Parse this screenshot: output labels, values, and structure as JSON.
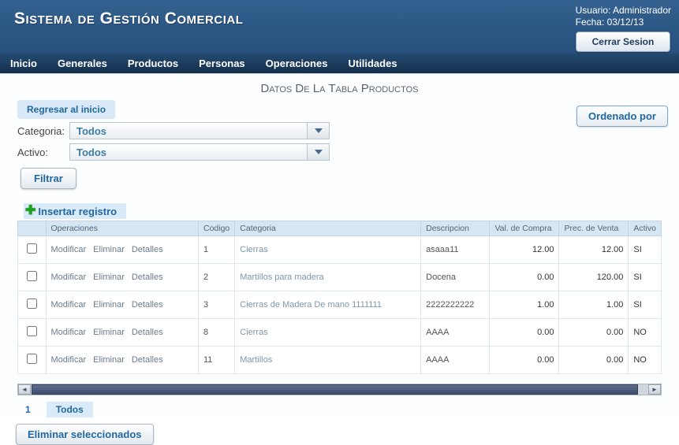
{
  "header": {
    "title": "Sistema de Gestión Comercial",
    "user_label": "Usuario: Administrador",
    "date_label": "Fecha: 03/12/13",
    "logout_button": "Cerrar Sesion"
  },
  "nav": {
    "items": [
      "Inicio",
      "Generales",
      "Productos",
      "Personas",
      "Operaciones",
      "Utilidades"
    ]
  },
  "main": {
    "page_title": "Datos De La Tabla Productos",
    "back_button": "Regresar al inicio",
    "filters": {
      "categoria_label": "Categoria:",
      "categoria_value": "Todos",
      "activo_label": "Activo:",
      "activo_value": "Todos",
      "filter_button": "Filtrar",
      "order_button": "Ordenado por"
    },
    "insert_link": "Insertar registro",
    "table": {
      "headers": [
        "Operaciones",
        "Codigo",
        "Categoria",
        "Descripcion",
        "Val. de Compra",
        "Prec. de Venta",
        "Activo"
      ],
      "row_actions": [
        "Modificar",
        "Eliminar",
        "Detalles"
      ],
      "rows": [
        {
          "codigo": "1",
          "categoria": "Cierras",
          "descripcion": "asaaa11",
          "val_compra": "12.00",
          "prec_venta": "12.00",
          "activo": "SI"
        },
        {
          "codigo": "2",
          "categoria": "Martillos para madera",
          "descripcion": "Docena",
          "val_compra": "0.00",
          "prec_venta": "120.00",
          "activo": "SI"
        },
        {
          "codigo": "3",
          "categoria": "Cierras de Madera De mano 1111111",
          "descripcion": "2222222222",
          "val_compra": "1.00",
          "prec_venta": "1.00",
          "activo": "SI"
        },
        {
          "codigo": "8",
          "categoria": "Cierras",
          "descripcion": "AAAA",
          "val_compra": "0.00",
          "prec_venta": "0.00",
          "activo": "NO"
        },
        {
          "codigo": "11",
          "categoria": "Martillos",
          "descripcion": "AAAA",
          "val_compra": "0.00",
          "prec_venta": "0.00",
          "activo": "NO"
        }
      ]
    },
    "pagination": {
      "page": "1",
      "all_label": "Todos"
    },
    "delete_button": "Eliminar seleccionados",
    "icons": {
      "plus": "✚",
      "arrow_left": "◄",
      "arrow_right": "►"
    }
  },
  "colors": {
    "header_bg": "#2b5687",
    "nav_bg": "#16324f",
    "accent_blue": "#2268a0",
    "light_blue_bg": "#d9eaf8",
    "table_header_bg": "#d6e6f3",
    "scroll_thumb": "#3e4e6c"
  }
}
